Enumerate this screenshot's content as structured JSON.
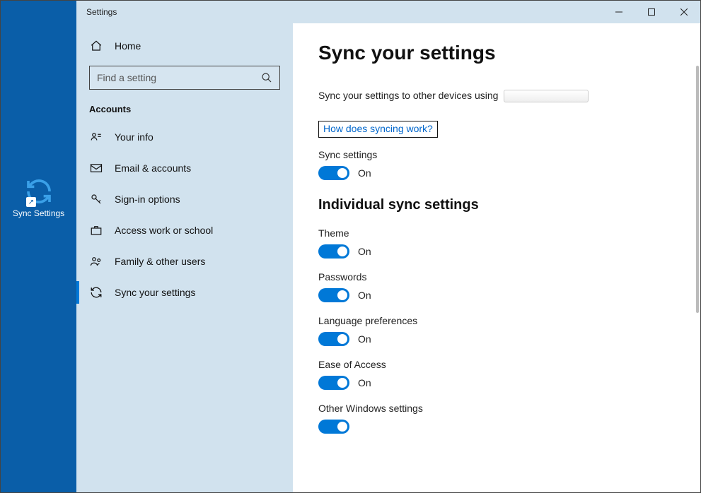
{
  "desktop_icon": {
    "label": "Sync Settings"
  },
  "window": {
    "title": "Settings",
    "controls": {
      "min": "minimize",
      "max": "maximize",
      "close": "close"
    }
  },
  "sidebar": {
    "home": "Home",
    "search_placeholder": "Find a setting",
    "section": "Accounts",
    "items": [
      {
        "icon": "person-card",
        "label": "Your info"
      },
      {
        "icon": "mail",
        "label": "Email & accounts"
      },
      {
        "icon": "key",
        "label": "Sign-in options"
      },
      {
        "icon": "briefcase",
        "label": "Access work or school"
      },
      {
        "icon": "people",
        "label": "Family & other users"
      },
      {
        "icon": "sync",
        "label": "Sync your settings"
      }
    ]
  },
  "content": {
    "heading": "Sync your settings",
    "desc_prefix": "Sync your settings to other devices using",
    "link": "How does syncing work?",
    "main_toggle": {
      "label": "Sync settings",
      "state": "On"
    },
    "sub_heading": "Individual sync settings",
    "toggles": [
      {
        "label": "Theme",
        "state": "On"
      },
      {
        "label": "Passwords",
        "state": "On"
      },
      {
        "label": "Language preferences",
        "state": "On"
      },
      {
        "label": "Ease of Access",
        "state": "On"
      },
      {
        "label": "Other Windows settings",
        "state": "On"
      }
    ]
  }
}
